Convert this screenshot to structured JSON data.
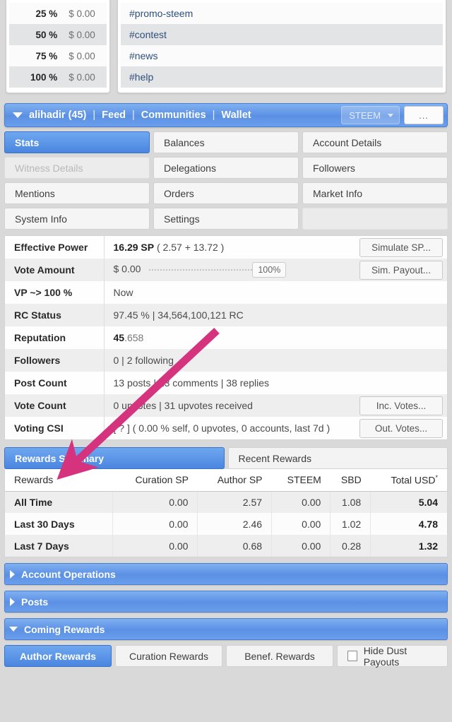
{
  "top_panels": {
    "vote_value_table": {
      "rows": [
        {
          "percent": "25 %",
          "amount": "$ 0.00"
        },
        {
          "percent": "50 %",
          "amount": "$ 0.00"
        },
        {
          "percent": "75 %",
          "amount": "$ 0.00"
        },
        {
          "percent": "100 %",
          "amount": "$ 0.00"
        }
      ]
    },
    "tags": [
      "#promo-steem",
      "#contest",
      "#news",
      "#help"
    ]
  },
  "header": {
    "username": "alihadir (45)",
    "sep": "|",
    "nav": [
      "Feed",
      "Communities",
      "Wallet"
    ],
    "currency_selected": "STEEM",
    "more_label": "..."
  },
  "tabs": [
    {
      "label": "Stats",
      "state": "active"
    },
    {
      "label": "Balances",
      "state": "normal"
    },
    {
      "label": "Account Details",
      "state": "normal"
    },
    {
      "label": "Witness Details",
      "state": "disabled"
    },
    {
      "label": "Delegations",
      "state": "normal"
    },
    {
      "label": "Followers",
      "state": "normal"
    },
    {
      "label": "Mentions",
      "state": "normal"
    },
    {
      "label": "Orders",
      "state": "normal"
    },
    {
      "label": "Market Info",
      "state": "normal"
    },
    {
      "label": "System Info",
      "state": "normal"
    },
    {
      "label": "Settings",
      "state": "normal"
    },
    {
      "label": "",
      "state": "empty"
    }
  ],
  "stats": {
    "effective_power": {
      "label": "Effective Power",
      "value_bold": "16.29 SP",
      "value_rest": "( 2.57 + 13.72 )",
      "button": "Simulate SP..."
    },
    "vote_amount": {
      "label": "Vote Amount",
      "value": "$ 0.00",
      "slider_value": "100%",
      "button": "Sim. Payout..."
    },
    "vp_to_100": {
      "label": "VP ~> 100 %",
      "value": "Now"
    },
    "rc_status": {
      "label": "RC Status",
      "value": "97.45 %  |  34,564,100,121 RC"
    },
    "reputation": {
      "label": "Reputation",
      "value_bold": "45",
      "value_rest": ".658"
    },
    "followers": {
      "label": "Followers",
      "value": "0  |  2 following"
    },
    "post_count": {
      "label": "Post Count",
      "value": "13 posts  |  13 comments  |  38 replies"
    },
    "vote_count": {
      "label": "Vote Count",
      "value": "0 upvotes  |  31 upvotes received",
      "button": "Inc. Votes..."
    },
    "voting_csi": {
      "label": "Voting CSI",
      "value": "[ ? ] ( 0.00 % self, 0 upvotes, 0 accounts, last 7d )",
      "button": "Out. Votes..."
    }
  },
  "rewards": {
    "tabs": [
      {
        "label": "Rewards Summary",
        "state": "active"
      },
      {
        "label": "Recent Rewards",
        "state": "normal"
      }
    ],
    "headers": [
      "Rewards",
      "Curation SP",
      "Author SP",
      "STEEM",
      "SBD",
      "Total USD"
    ],
    "total_usd_asterisk": "*",
    "rows": [
      {
        "period": "All Time",
        "curation_sp": "0.00",
        "author_sp": "2.57",
        "steem": "0.00",
        "sbd": "1.08",
        "total_usd": "5.04"
      },
      {
        "period": "Last 30 Days",
        "curation_sp": "0.00",
        "author_sp": "2.46",
        "steem": "0.00",
        "sbd": "1.02",
        "total_usd": "4.78"
      },
      {
        "period": "Last 7 Days",
        "curation_sp": "0.00",
        "author_sp": "0.68",
        "steem": "0.00",
        "sbd": "0.28",
        "total_usd": "1.32"
      }
    ]
  },
  "accordions": [
    {
      "label": "Account Operations",
      "expanded": false
    },
    {
      "label": "Posts",
      "expanded": false
    },
    {
      "label": "Coming Rewards",
      "expanded": true
    }
  ],
  "bottom_tabs": [
    {
      "label": "Author Rewards",
      "state": "active"
    },
    {
      "label": "Curation Rewards",
      "state": "normal"
    },
    {
      "label": "Benef. Rewards",
      "state": "normal"
    }
  ],
  "hide_dust": {
    "label": "Hide Dust Payouts",
    "checked": false
  },
  "annotation": {
    "type": "arrow",
    "color": "#d6337f"
  },
  "colors": {
    "accent_blue": "#4a86e0",
    "header_blue": "#5e93e6",
    "link_blue": "#2e4f7c",
    "arrow_pink": "#d6337f",
    "page_bg": "#d9d9d9"
  }
}
